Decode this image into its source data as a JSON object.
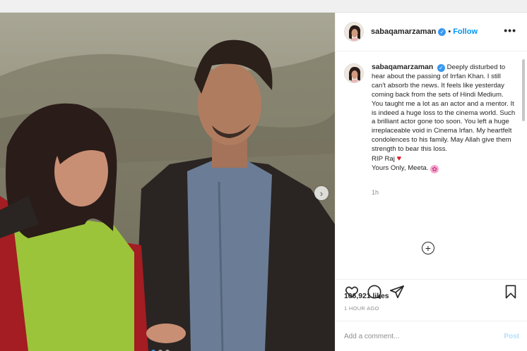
{
  "post": {
    "username": "sabaqamarzaman",
    "separator": "•",
    "follow_label": "Follow",
    "more_icon": "more-options-icon",
    "verified_glyph": "✓",
    "caption_username": "sabaqamarzaman",
    "caption_lines": [
      "Deeply disturbed to hear about the passing of Irrfan Khan. I still can't absorb the news. It feels like yesterday coming back from the sets of Hindi Medium. You taught me a lot as an actor and a mentor. It is indeed a huge loss to the cinema world. Such a brilliant actor gone too soon. You left a huge irreplaceable void in Cinema Irfan. My heartfelt condolences to his family. May Allah give them strength to bear this loss."
    ],
    "rip_text": "RIP Raj",
    "rip_emoji": "♥",
    "signoff_text": "Yours Only, Meeta.",
    "signoff_emoji": "✿",
    "comment_time": "1h",
    "load_more_glyph": "+",
    "likes": "106,921 likes",
    "posted_ago": "1 HOUR AGO",
    "comment_placeholder": "Add a comment...",
    "post_label": "Post"
  },
  "carousel": {
    "next_glyph": "›",
    "slide_count": 3,
    "active_slide": 1
  },
  "colors": {
    "accent": "#0095f6",
    "verified": "#3897f0",
    "heart": "#d91c2b",
    "post_disabled": "#b2dffc"
  }
}
